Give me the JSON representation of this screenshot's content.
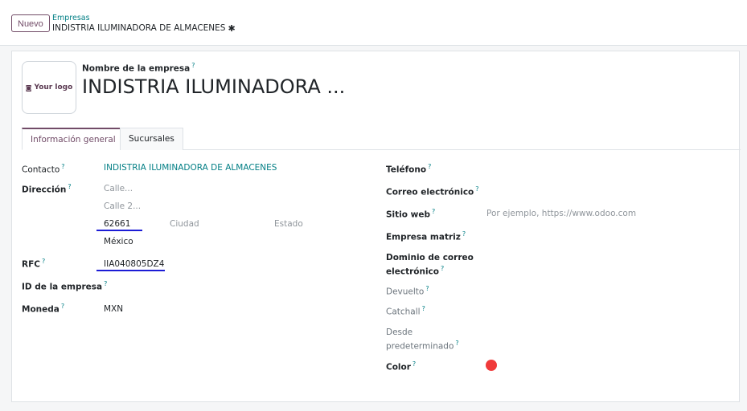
{
  "header": {
    "new_button": "Nuevo",
    "breadcrumb_parent": "Empresas",
    "breadcrumb_current": "INDISTRIA ILUMINADORA DE ALMACENES"
  },
  "form": {
    "logo_placeholder": "Your logo",
    "name_label": "Nombre de la empresa",
    "name_value": "INDISTRIA ILUMINADORA ...",
    "tabs": [
      {
        "label": "Información general",
        "active": true
      },
      {
        "label": "Sucursales",
        "active": false
      }
    ],
    "left": {
      "contact_label": "Contacto",
      "contact_value": "INDISTRIA ILUMINADORA DE ALMACENES",
      "address_label": "Dirección",
      "street_placeholder": "Calle...",
      "street2_placeholder": "Calle 2...",
      "zip_value": "62661",
      "city_placeholder": "Ciudad",
      "state_placeholder": "Estado",
      "country_value": "México",
      "rfc_label": "RFC",
      "rfc_value": "IIA040805DZ4",
      "company_id_label": "ID de la empresa",
      "currency_label": "Moneda",
      "currency_value": "MXN"
    },
    "right": {
      "phone_label": "Teléfono",
      "email_label": "Correo electrónico",
      "website_label": "Sitio web",
      "website_placeholder": "Por ejemplo, https://www.odoo.com",
      "parent_label": "Empresa matriz",
      "email_domain_label_1": "Dominio de correo",
      "email_domain_label_2": "electrónico",
      "bounce_label": "Devuelto",
      "catchall_label": "Catchall",
      "default_label_1": "Desde",
      "default_label_2": "predeterminado",
      "color_label": "Color",
      "color_value": "#f03a3a"
    },
    "help_mark": "?"
  }
}
